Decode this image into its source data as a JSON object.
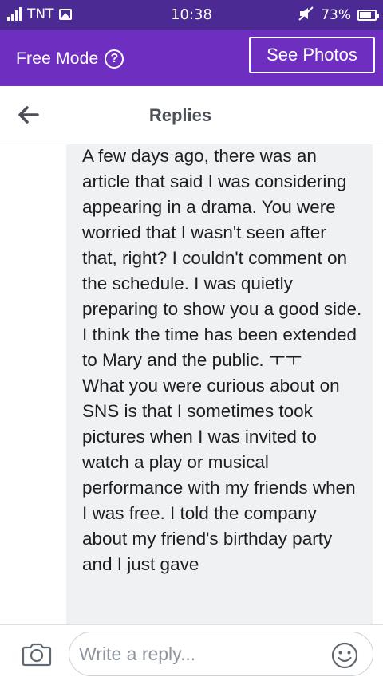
{
  "status_bar": {
    "carrier": "TNT",
    "time": "10:38",
    "battery": "73%",
    "icons": [
      "signal-icon",
      "image-icon",
      "mute-icon",
      "battery-icon"
    ]
  },
  "mode_bar": {
    "free_mode_label": "Free Mode",
    "help_icon": "?",
    "see_photos_label": "See Photos",
    "color": "#6e2fc1"
  },
  "header": {
    "title": "Replies",
    "back_icon": "back-arrow-icon"
  },
  "comment": {
    "text": "A few days ago, there was an article that said I was considering appearing in a drama. You were worried that I wasn't seen after that, right? I couldn't comment on the schedule. I was quietly preparing to show you a good side. I think the time has been extended to Mary and the public. ㅜㅜ\nWhat you were curious about on SNS is that I sometimes took pictures when I was invited to watch a play or musical performance with my friends when I was free. I told the company about my friend's birthday party and I just gave"
  },
  "composer": {
    "placeholder": "Write a reply...",
    "camera_icon": "camera-icon",
    "emoji_icon": "emoji-icon"
  }
}
